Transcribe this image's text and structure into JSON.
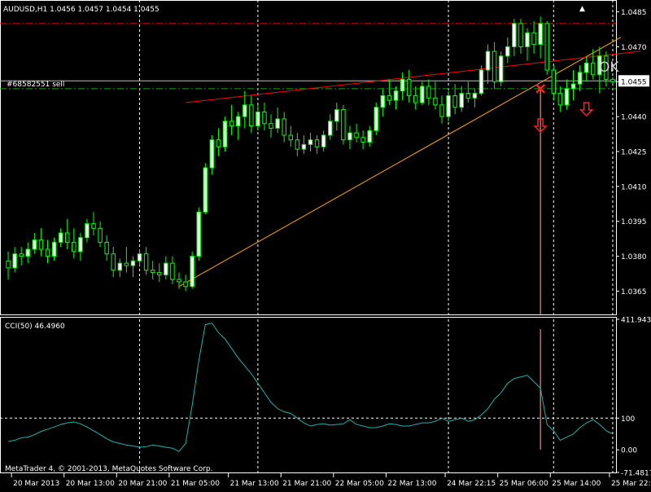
{
  "chart_data": [
    {
      "type": "candlestick",
      "header": {
        "symbol_period": "AUDUSD,H1",
        "ohlc": "1.0456 1.0457 1.0454 1.0455"
      },
      "price_axis": {
        "ylim": [
          1.0355,
          1.0488
        ],
        "ticks": [
          "1.0485",
          "1.0470",
          "1.0455",
          "1.0440",
          "1.0425",
          "1.0410",
          "1.0395",
          "1.0380",
          "1.0365"
        ],
        "tick_values": [
          1.0485,
          1.047,
          1.0455,
          1.044,
          1.0425,
          1.041,
          1.0395,
          1.038,
          1.0365
        ],
        "current_price": "1.0455",
        "current_price_value": 1.0455
      },
      "time_axis": {
        "labels": [
          "20 Mar 2013",
          "20 Mar 13:00",
          "20 Mar 21:00",
          "21 Mar 05:00",
          "21 Mar 13:00",
          "21 Mar 21:00",
          "22 Mar 05:00",
          "22 Mar 13:00",
          "24 Mar 22:15",
          "25 Mar 06:00",
          "25 Mar 14:00",
          "25 Mar 22:01"
        ],
        "label_bar_index": [
          1,
          9,
          17,
          25,
          34,
          42,
          50,
          58,
          67,
          75,
          83,
          92
        ]
      },
      "vertical_grid_bar_index": [
        20,
        38,
        67,
        83,
        92
      ],
      "candles": [
        [
          1.0378,
          1.0382,
          1.037,
          1.0375
        ],
        [
          1.0375,
          1.0384,
          1.0373,
          1.0381
        ],
        [
          1.0381,
          1.0384,
          1.0376,
          1.038
        ],
        [
          1.038,
          1.0386,
          1.0377,
          1.0383
        ],
        [
          1.0383,
          1.039,
          1.0381,
          1.0387
        ],
        [
          1.0387,
          1.0392,
          1.038,
          1.0383
        ],
        [
          1.0383,
          1.0387,
          1.0377,
          1.038
        ],
        [
          1.038,
          1.0388,
          1.0378,
          1.0386
        ],
        [
          1.0386,
          1.0392,
          1.0384,
          1.039
        ],
        [
          1.039,
          1.0396,
          1.0383,
          1.0386
        ],
        [
          1.0386,
          1.0392,
          1.0379,
          1.0382
        ],
        [
          1.0382,
          1.039,
          1.0378,
          1.0388
        ],
        [
          1.0388,
          1.0396,
          1.0386,
          1.0394
        ],
        [
          1.0394,
          1.0399,
          1.0389,
          1.0392
        ],
        [
          1.0392,
          1.0395,
          1.0384,
          1.0386
        ],
        [
          1.0386,
          1.0389,
          1.0378,
          1.0381
        ],
        [
          1.0381,
          1.0384,
          1.0371,
          1.0374
        ],
        [
          1.0374,
          1.0379,
          1.0371,
          1.0377
        ],
        [
          1.0377,
          1.0384,
          1.0373,
          1.0376
        ],
        [
          1.0376,
          1.038,
          1.0371,
          1.0378
        ],
        [
          1.0378,
          1.0383,
          1.0376,
          1.0381
        ],
        [
          1.0381,
          1.0384,
          1.0372,
          1.0374
        ],
        [
          1.0374,
          1.0378,
          1.037,
          1.0373
        ],
        [
          1.0373,
          1.0377,
          1.0369,
          1.0372
        ],
        [
          1.0372,
          1.038,
          1.037,
          1.0377
        ],
        [
          1.0377,
          1.038,
          1.0368,
          1.037
        ],
        [
          1.037,
          1.0373,
          1.0366,
          1.0369
        ],
        [
          1.0369,
          1.0372,
          1.0365,
          1.0367
        ],
        [
          1.0367,
          1.0382,
          1.0366,
          1.038
        ],
        [
          1.038,
          1.0401,
          1.0378,
          1.0399
        ],
        [
          1.0399,
          1.042,
          1.0398,
          1.0418
        ],
        [
          1.0418,
          1.0432,
          1.0415,
          1.043
        ],
        [
          1.043,
          1.0435,
          1.0423,
          1.0427
        ],
        [
          1.0427,
          1.044,
          1.0425,
          1.0438
        ],
        [
          1.0438,
          1.0445,
          1.0432,
          1.0436
        ],
        [
          1.0436,
          1.0442,
          1.043,
          1.044
        ],
        [
          1.044,
          1.0451,
          1.0435,
          1.0445
        ],
        [
          1.0445,
          1.0449,
          1.0433,
          1.0436
        ],
        [
          1.0436,
          1.0445,
          1.0434,
          1.0442
        ],
        [
          1.0442,
          1.0446,
          1.0434,
          1.0437
        ],
        [
          1.0437,
          1.0441,
          1.0431,
          1.0435
        ],
        [
          1.0435,
          1.0444,
          1.0433,
          1.0439
        ],
        [
          1.0439,
          1.0442,
          1.0429,
          1.0432
        ],
        [
          1.0432,
          1.0436,
          1.0427,
          1.043
        ],
        [
          1.043,
          1.0433,
          1.0423,
          1.0426
        ],
        [
          1.0426,
          1.0432,
          1.0424,
          1.0428
        ],
        [
          1.0428,
          1.0433,
          1.0425,
          1.043
        ],
        [
          1.043,
          1.0432,
          1.0424,
          1.0427
        ],
        [
          1.0427,
          1.0434,
          1.0425,
          1.0432
        ],
        [
          1.0432,
          1.0441,
          1.043,
          1.0438
        ],
        [
          1.0438,
          1.0446,
          1.0434,
          1.0443
        ],
        [
          1.0443,
          1.0445,
          1.0428,
          1.043
        ],
        [
          1.043,
          1.0436,
          1.0426,
          1.0433
        ],
        [
          1.0433,
          1.0437,
          1.0429,
          1.0431
        ],
        [
          1.0431,
          1.0434,
          1.0426,
          1.0429
        ],
        [
          1.0429,
          1.0436,
          1.0427,
          1.0434
        ],
        [
          1.0434,
          1.0446,
          1.0432,
          1.0444
        ],
        [
          1.0444,
          1.0452,
          1.044,
          1.0449
        ],
        [
          1.0449,
          1.0456,
          1.0445,
          1.0447
        ],
        [
          1.0447,
          1.0453,
          1.0443,
          1.0451
        ],
        [
          1.0451,
          1.0459,
          1.0447,
          1.0456
        ],
        [
          1.0456,
          1.046,
          1.0446,
          1.0449
        ],
        [
          1.0449,
          1.0453,
          1.0443,
          1.0446
        ],
        [
          1.0446,
          1.0455,
          1.0445,
          1.0453
        ],
        [
          1.0453,
          1.0456,
          1.0445,
          1.0448
        ],
        [
          1.0448,
          1.0455,
          1.0443,
          1.0445
        ],
        [
          1.0445,
          1.0449,
          1.0437,
          1.044
        ],
        [
          1.044,
          1.0451,
          1.0438,
          1.0449
        ],
        [
          1.0449,
          1.0454,
          1.0441,
          1.0444
        ],
        [
          1.0444,
          1.0453,
          1.0442,
          1.045
        ],
        [
          1.045,
          1.0455,
          1.0446,
          1.0448
        ],
        [
          1.0448,
          1.0452,
          1.0444,
          1.045
        ],
        [
          1.045,
          1.0462,
          1.0449,
          1.046
        ],
        [
          1.046,
          1.0471,
          1.0454,
          1.0468
        ],
        [
          1.0468,
          1.0472,
          1.0452,
          1.0455
        ],
        [
          1.0455,
          1.0468,
          1.0453,
          1.0466
        ],
        [
          1.0466,
          1.0474,
          1.0463,
          1.047
        ],
        [
          1.047,
          1.0482,
          1.0466,
          1.048
        ],
        [
          1.048,
          1.0482,
          1.0467,
          1.047
        ],
        [
          1.047,
          1.0478,
          1.0464,
          1.0476
        ],
        [
          1.0476,
          1.0481,
          1.0467,
          1.0471
        ],
        [
          1.0471,
          1.0483,
          1.0465,
          1.048
        ],
        [
          1.048,
          1.0481,
          1.0458,
          1.046
        ],
        [
          1.046,
          1.0462,
          1.0447,
          1.045
        ],
        [
          1.045,
          1.0453,
          1.0442,
          1.0445
        ],
        [
          1.0445,
          1.0456,
          1.0443,
          1.0452
        ],
        [
          1.0452,
          1.046,
          1.0447,
          1.0454
        ],
        [
          1.0454,
          1.0462,
          1.0451,
          1.0459
        ],
        [
          1.0459,
          1.0466,
          1.0455,
          1.0463
        ],
        [
          1.0463,
          1.0469,
          1.0456,
          1.0458
        ],
        [
          1.0458,
          1.047,
          1.045,
          1.0466
        ],
        [
          1.0466,
          1.0468,
          1.0453,
          1.0456
        ],
        [
          1.0456,
          1.0457,
          1.0454,
          1.0455
        ]
      ],
      "horizontal_lines": [
        {
          "price": 1.048,
          "color": "#ff0000",
          "style": "dash-dot"
        },
        {
          "price": 1.0452,
          "color": "#00b000",
          "style": "dash-dot",
          "label": "#68582551 sell"
        }
      ],
      "trendlines": [
        {
          "from": [
            26,
            1.0367
          ],
          "to": [
            91,
            1.0472
          ],
          "color": "#ffa500"
        },
        {
          "from": [
            27,
            1.0446
          ],
          "to": [
            94,
            1.0466
          ],
          "color": "#ff0000"
        }
      ],
      "annotations": {
        "ok_label": "OK",
        "sell_marker_bar": 81,
        "sell_marker_price": 1.0452,
        "down_arrows": [
          {
            "bar": 81,
            "price": 1.0439
          },
          {
            "bar": 88,
            "price": 1.0446
          }
        ],
        "signal_line_bar": 81
      },
      "colors": {
        "bull": "#ffffff",
        "bear": "#000000",
        "wick": "#00ff00",
        "grid": "#ffffff",
        "cci": "#20b2aa",
        "ask_line": "#c0c0c0"
      }
    },
    {
      "type": "line",
      "title": "CCI(50) 46.4960",
      "ylim": [
        -71.4817,
        411.9435
      ],
      "ticks": [
        "411.9435",
        "100",
        "0.00",
        "-71.4817"
      ],
      "tick_values": [
        411.9435,
        100,
        0,
        -71.4817
      ],
      "levels": [
        100
      ],
      "values": [
        26,
        30,
        38,
        40,
        48,
        58,
        65,
        72,
        80,
        85,
        88,
        82,
        72,
        60,
        48,
        35,
        25,
        20,
        15,
        12,
        8,
        10,
        15,
        12,
        8,
        5,
        -5,
        20,
        140,
        280,
        395,
        400,
        370,
        350,
        320,
        290,
        265,
        240,
        210,
        180,
        150,
        130,
        120,
        115,
        100,
        85,
        75,
        80,
        82,
        78,
        80,
        82,
        95,
        80,
        75,
        70,
        70,
        75,
        82,
        80,
        75,
        75,
        80,
        85,
        85,
        90,
        100,
        90,
        95,
        100,
        90,
        95,
        110,
        130,
        160,
        180,
        210,
        225,
        230,
        235,
        215,
        195,
        80,
        60,
        30,
        40,
        50,
        70,
        85,
        95,
        80,
        60,
        50
      ]
    }
  ],
  "footer": {
    "copyright": "MetaTrader 4, © 2001-2013, MetaQuotes Software Corp."
  },
  "window_buttons": {
    "restore_symbol": "▲"
  }
}
